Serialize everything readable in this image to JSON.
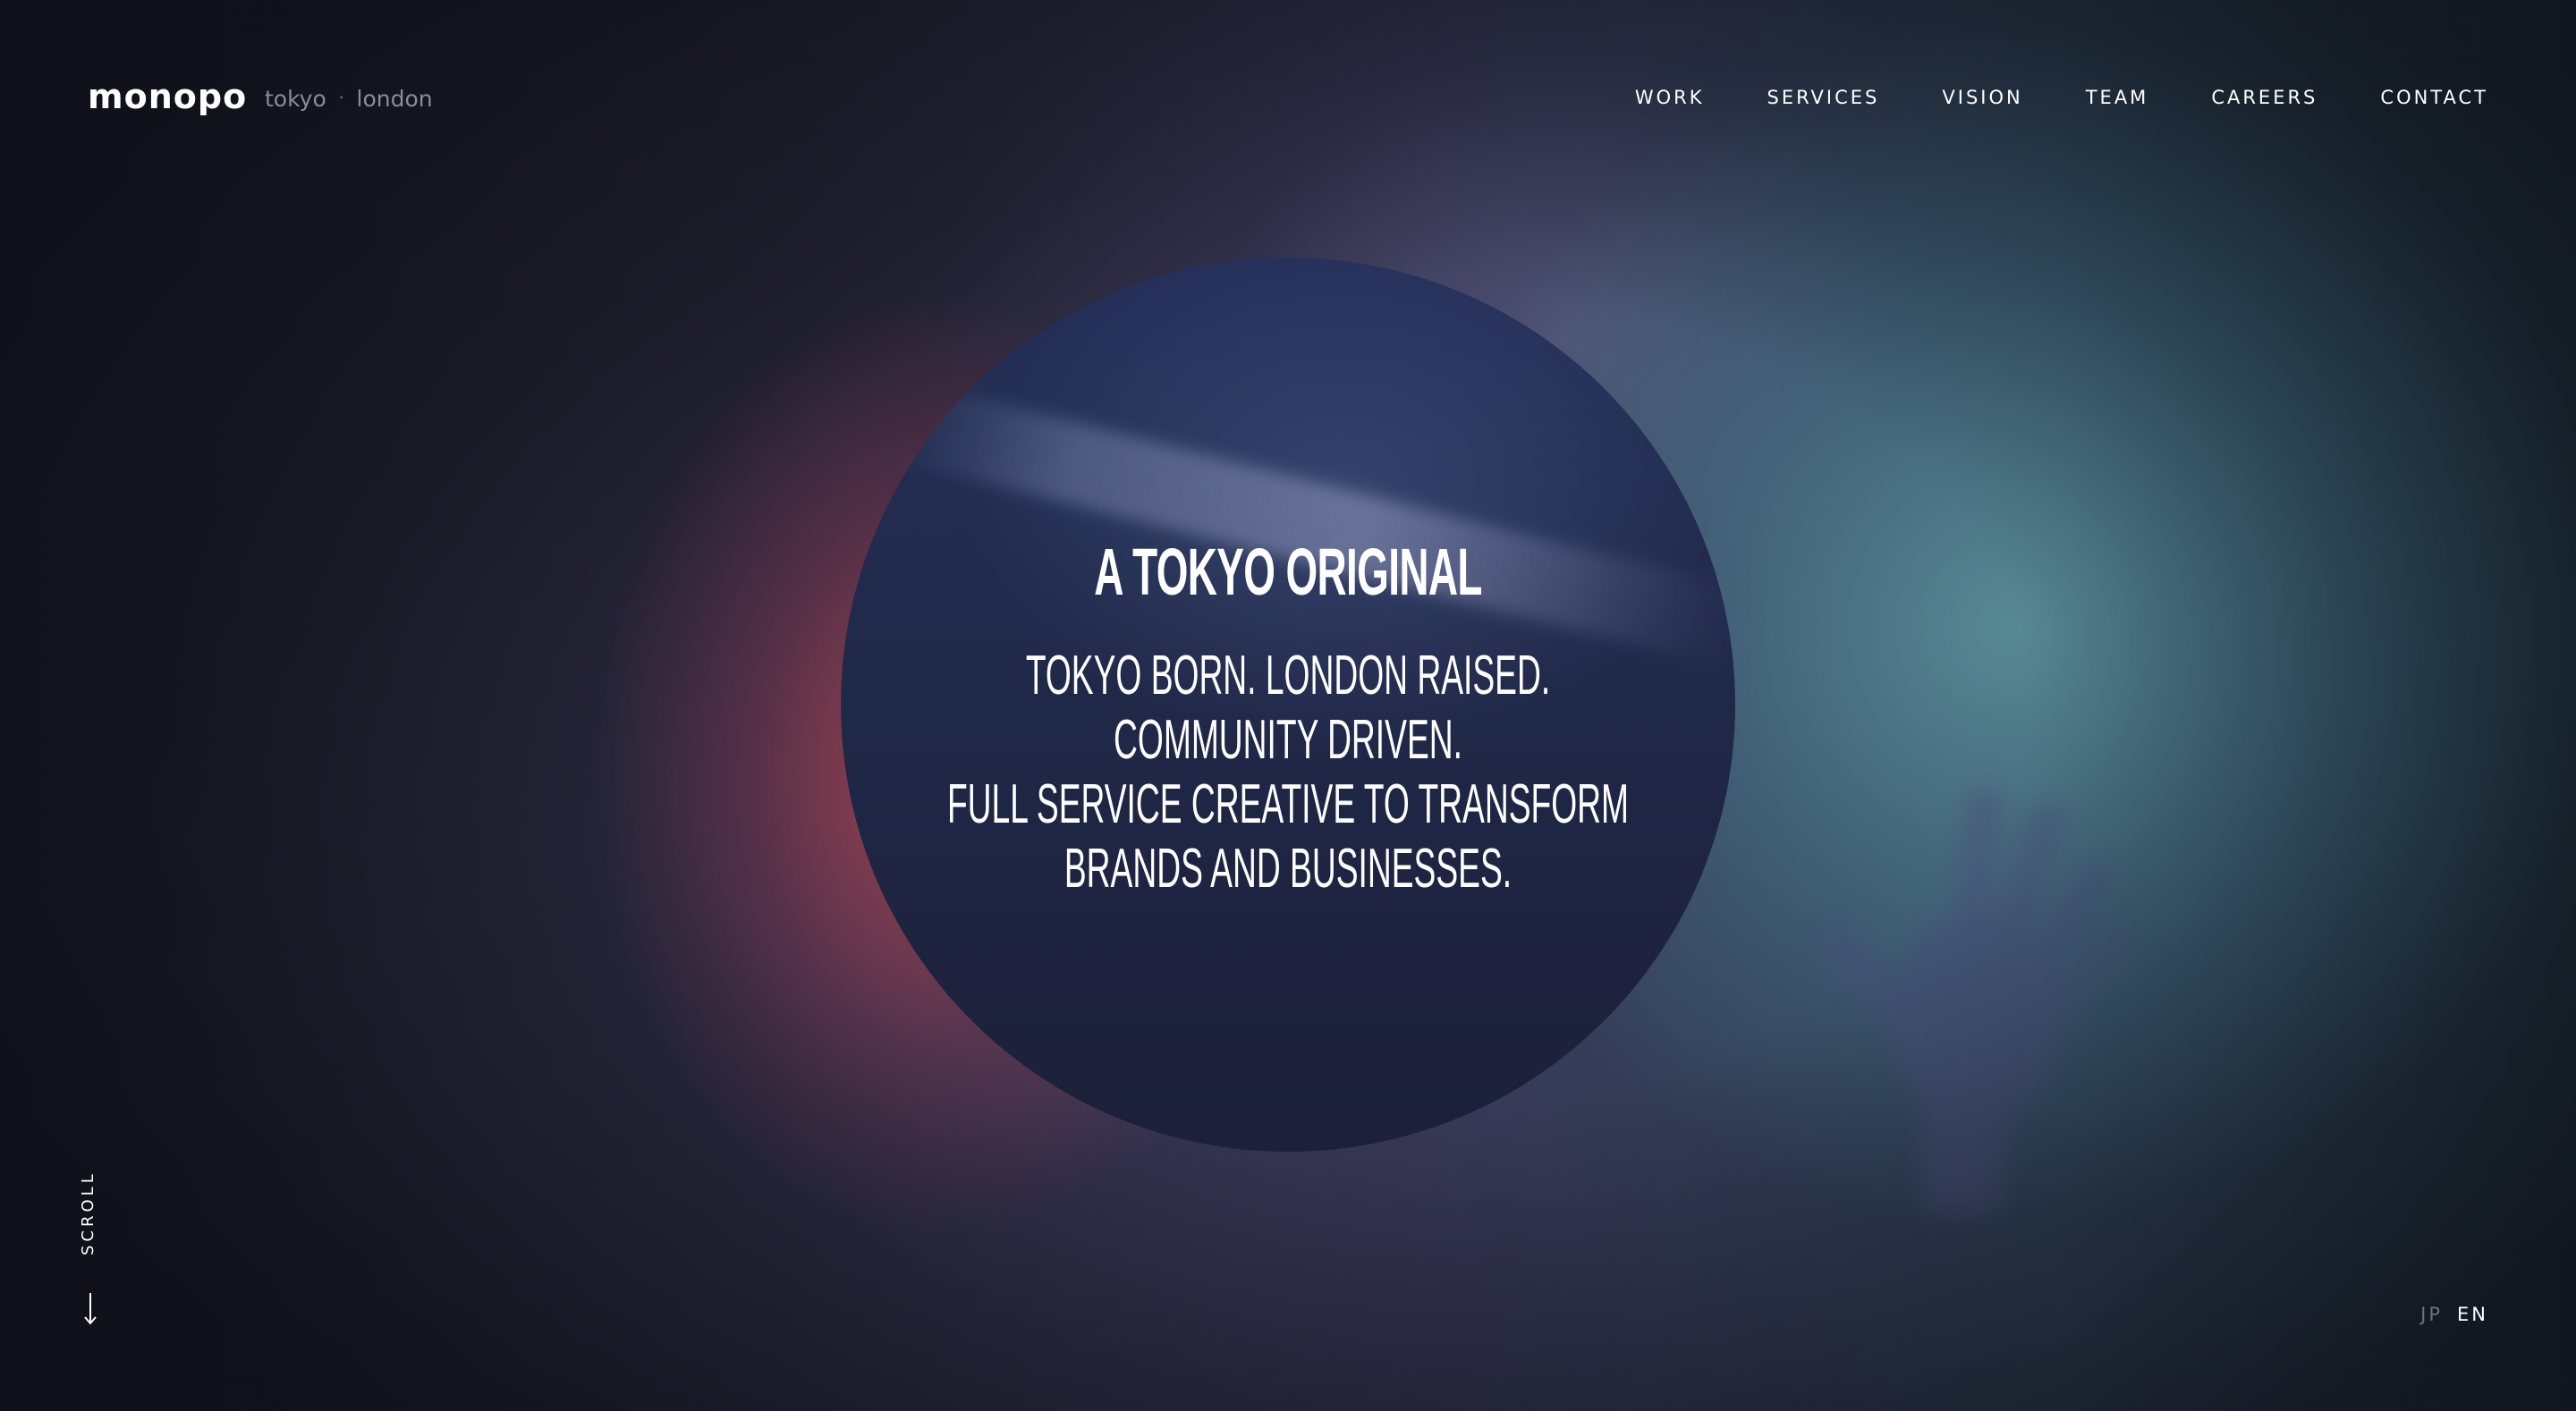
{
  "header": {
    "logo": "monopo",
    "locations": [
      "tokyo",
      "london"
    ],
    "separator": "·"
  },
  "nav": {
    "items": [
      {
        "label": "WORK"
      },
      {
        "label": "SERVICES"
      },
      {
        "label": "VISION"
      },
      {
        "label": "TEAM"
      },
      {
        "label": "CAREERS"
      },
      {
        "label": "CONTACT"
      }
    ]
  },
  "hero": {
    "title": "A TOKYO ORIGINAL",
    "lines": [
      "TOKYO BORN. LONDON RAISED.",
      "COMMUNITY DRIVEN.",
      "FULL SERVICE CREATIVE TO TRANSFORM",
      "BRANDS AND BUSINESSES."
    ]
  },
  "scroll": {
    "label": "SCROLL",
    "icon": "arrow-down-icon"
  },
  "language": {
    "options": [
      "JP",
      "EN"
    ],
    "selected": "EN"
  },
  "colors": {
    "text": "#ffffff",
    "muted": "#8a8c9c",
    "circle": "#212a4c"
  }
}
